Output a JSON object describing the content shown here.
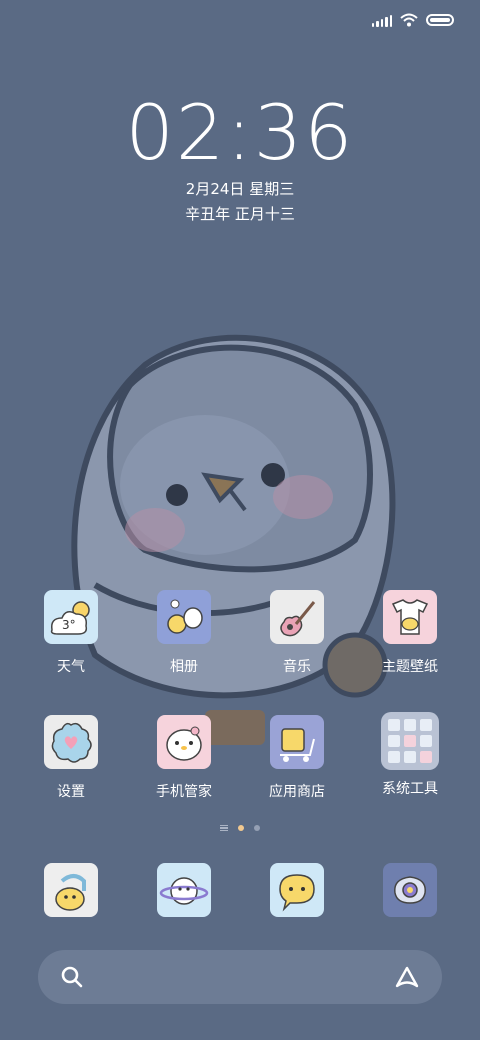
{
  "status_bar": {
    "signal_icon": "signal-icon",
    "wifi_icon": "wifi-icon",
    "battery_icon": "battery-icon"
  },
  "clock": {
    "time": "02:36",
    "date": "2月24日 星期三",
    "lunar_date": "辛丑年 正月十三"
  },
  "apps": [
    {
      "label": "天气",
      "icon": "weather-icon",
      "weather_text": "3°"
    },
    {
      "label": "相册",
      "icon": "gallery-icon"
    },
    {
      "label": "音乐",
      "icon": "music-icon"
    },
    {
      "label": "主题壁纸",
      "icon": "themes-icon"
    },
    {
      "label": "设置",
      "icon": "settings-icon"
    },
    {
      "label": "手机管家",
      "icon": "security-icon"
    },
    {
      "label": "应用商店",
      "icon": "app-store-icon"
    },
    {
      "label": "系统工具",
      "icon": "system-tools-folder-icon"
    }
  ],
  "dock": [
    {
      "icon": "phone-icon"
    },
    {
      "icon": "browser-icon"
    },
    {
      "icon": "messages-icon"
    },
    {
      "icon": "camera-icon"
    }
  ],
  "page_indicator": {
    "pages": 2,
    "current": 1
  },
  "search_bar": {
    "search_icon": "search-icon",
    "assistant_icon": "assistant-icon"
  },
  "colors": {
    "background": "#5a6a84",
    "accent_dot": "#f2c990"
  }
}
